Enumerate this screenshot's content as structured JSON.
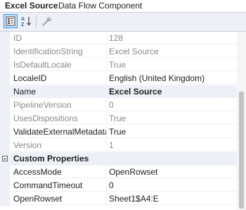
{
  "header": {
    "object_name": "Excel Source",
    "object_type": "Data Flow Component"
  },
  "toolbar": {
    "categorized_icon": "categorized-icon",
    "alphabetical_icon": "sort-az-icon",
    "property_pages_icon": "wrench-icon"
  },
  "rows": [
    {
      "name": "ID",
      "value": "128"
    },
    {
      "name": "IdentificationString",
      "value": "Excel Source"
    },
    {
      "name": "IsDefaultLocale",
      "value": "True"
    },
    {
      "name": "LocaleID",
      "value": "English (United Kingdom)"
    },
    {
      "name": "Name",
      "value": "Excel Source"
    },
    {
      "name": "PipelineVersion",
      "value": "0"
    },
    {
      "name": "UsesDispositions",
      "value": "True"
    },
    {
      "name": "ValidateExternalMetadata",
      "value": "True"
    },
    {
      "name": "Version",
      "value": "1"
    }
  ],
  "category": {
    "label": "Custom Properties"
  },
  "custom_rows": [
    {
      "name": "AccessMode",
      "value": "OpenRowset"
    },
    {
      "name": "CommandTimeout",
      "value": "0"
    },
    {
      "name": "OpenRowset",
      "value": "Sheet1$A4:E"
    }
  ]
}
